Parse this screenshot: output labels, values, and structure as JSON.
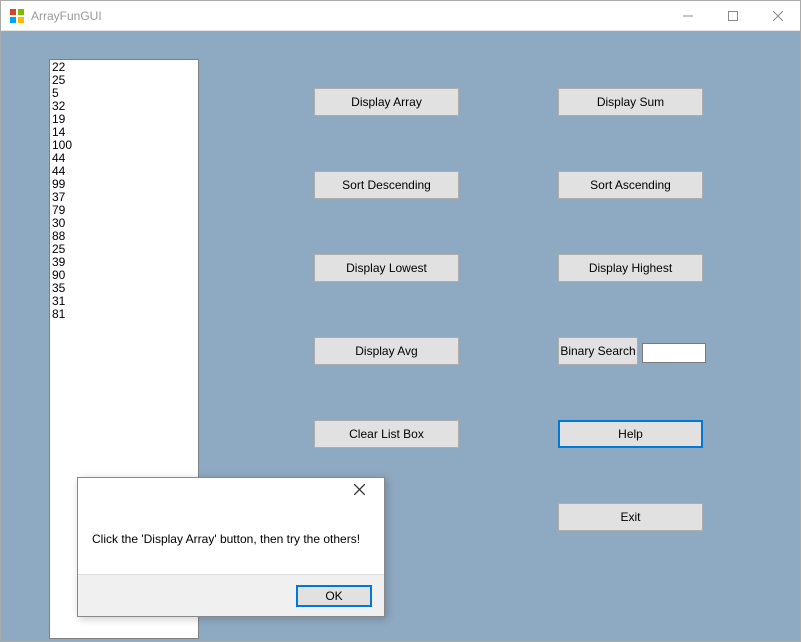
{
  "window": {
    "title": "ArrayFunGUI"
  },
  "listbox": {
    "items": [
      "22",
      "25",
      "5",
      "32",
      "19",
      "14",
      "100",
      "44",
      "44",
      "99",
      "37",
      "79",
      "30",
      "88",
      "25",
      "39",
      "90",
      "35",
      "31",
      "81"
    ]
  },
  "buttons": {
    "display_array": "Display Array",
    "display_sum": "Display Sum",
    "sort_descending": "Sort Descending",
    "sort_ascending": "Sort Ascending",
    "display_lowest": "Display Lowest",
    "display_highest": "Display Highest",
    "display_avg": "Display Avg",
    "binary_search": "Binary Search",
    "clear_list_box": "Clear List Box",
    "help": "Help",
    "exit": "Exit"
  },
  "binary_search_input": {
    "value": ""
  },
  "dialog": {
    "message": "Click the 'Display Array' button, then try the others!",
    "ok": "OK"
  }
}
